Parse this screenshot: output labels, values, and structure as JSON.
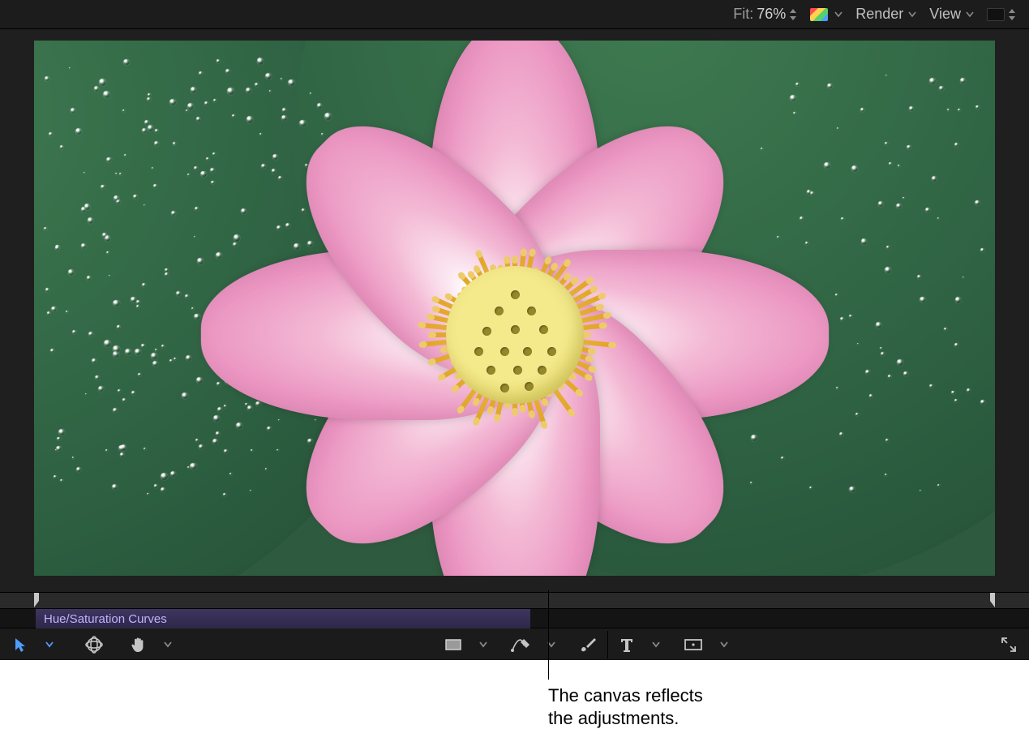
{
  "topbar": {
    "fit_label": "Fit:",
    "fit_value": "76%",
    "render_label": "Render",
    "view_label": "View"
  },
  "clip": {
    "name": "Hue/Saturation Curves"
  },
  "callout": {
    "text": "The canvas reflects\nthe adjustments."
  },
  "icons": {
    "select": "select-tool",
    "orbit": "3d-transform-tool",
    "hand": "hand-tool",
    "rect": "rectangle-mask-tool",
    "pen": "pen-bezier-tool",
    "brush": "paint-stroke-tool",
    "text": "text-tool",
    "generator": "generator-rectangle-tool",
    "expand": "expand-viewer-icon"
  }
}
